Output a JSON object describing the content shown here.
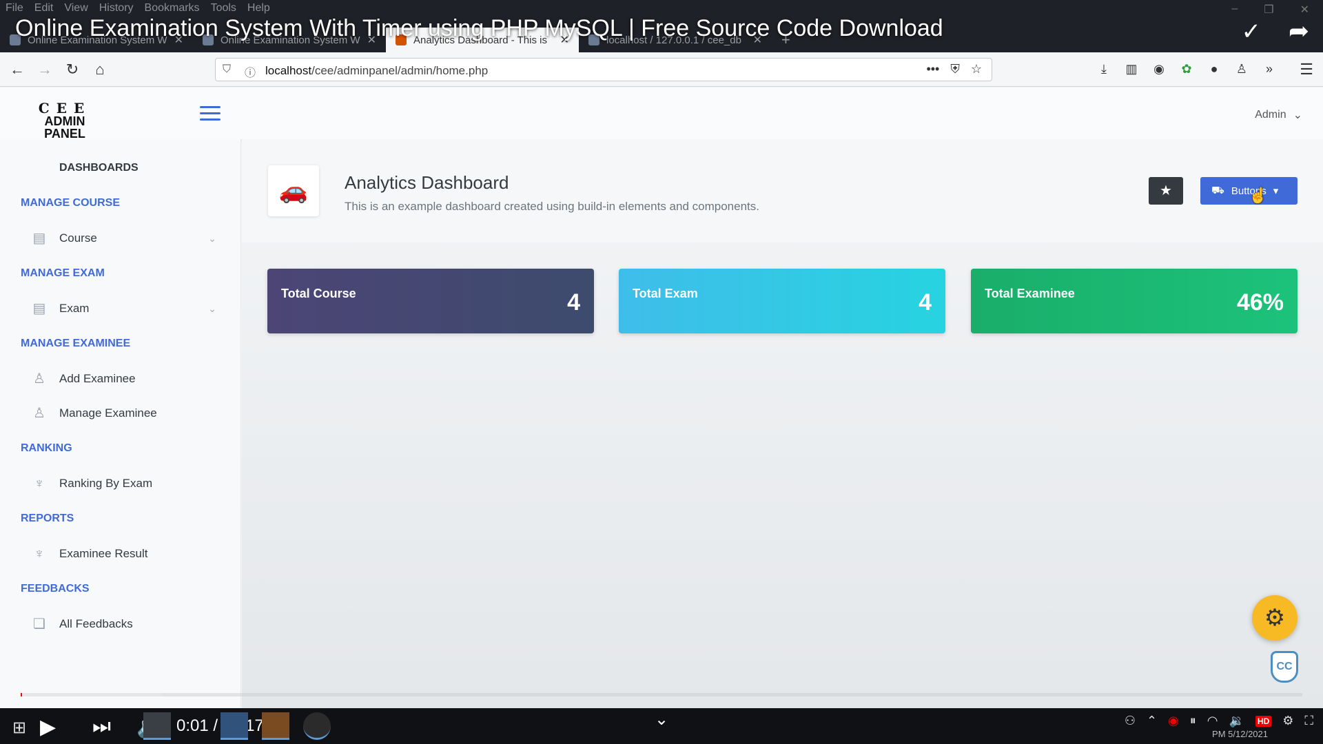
{
  "video": {
    "title": "Online Examination System With Timer using PHP MySQL | Free Source Code Download",
    "time": "0:01 / 14:17",
    "progress_buffer": 0.11,
    "progress_played": 0.0012
  },
  "browser": {
    "menu": [
      "File",
      "Edit",
      "View",
      "History",
      "Bookmarks",
      "Tools",
      "Help"
    ],
    "tabs": [
      {
        "title": "Online Examination System W",
        "active": false
      },
      {
        "title": "Online Examination System W",
        "active": false
      },
      {
        "title": "Analytics Dashboard - This is",
        "active": true
      },
      {
        "title": "localhost / 127.0.0.1 / cee_db",
        "active": false
      }
    ],
    "url_host": "localhost",
    "url_path": "/cee/adminpanel/admin/home.php",
    "url_more": "•••"
  },
  "header": {
    "logo_top": "CEE",
    "logo_bottom": "ADMIN PANEL",
    "user": "Admin"
  },
  "sidebar": {
    "dashboards": "DASHBOARDS",
    "sections": [
      {
        "heading": "MANAGE COURSE",
        "items": [
          {
            "label": "Course",
            "icon": "list-icon",
            "chevron": true
          }
        ]
      },
      {
        "heading": "MANAGE EXAM",
        "items": [
          {
            "label": "Exam",
            "icon": "list-icon",
            "chevron": true
          }
        ]
      },
      {
        "heading": "MANAGE EXAMINEE",
        "items": [
          {
            "label": "Add Examinee",
            "icon": "add-user-icon"
          },
          {
            "label": "Manage Examinee",
            "icon": "users-icon"
          }
        ]
      },
      {
        "heading": "RANKING",
        "items": [
          {
            "label": "Ranking By Exam",
            "icon": "trophy-icon"
          }
        ]
      },
      {
        "heading": "REPORTS",
        "items": [
          {
            "label": "Examinee Result",
            "icon": "trophy-icon"
          }
        ]
      },
      {
        "heading": "FEEDBACKS",
        "items": [
          {
            "label": "All Feedbacks",
            "icon": "comments-icon"
          }
        ]
      }
    ]
  },
  "main": {
    "title": "Analytics Dashboard",
    "subtitle": "This is an example dashboard created using build-in elements and components.",
    "buttons_label": "Buttons",
    "cards": [
      {
        "label": "Total Course",
        "value": "4",
        "color": "#444054"
      },
      {
        "label": "Total Exam",
        "value": "4",
        "color": "#30c1e8"
      },
      {
        "label": "Total Examinee",
        "value": "46%",
        "color": "#1cb070"
      }
    ]
  },
  "taskbar": {
    "tray_time": "PM",
    "tray_date": "5/12/2021",
    "hd": "HD"
  },
  "colors": {
    "accent": "#3f6ad8",
    "dark": "#343a40",
    "warning": "#f7b924"
  }
}
